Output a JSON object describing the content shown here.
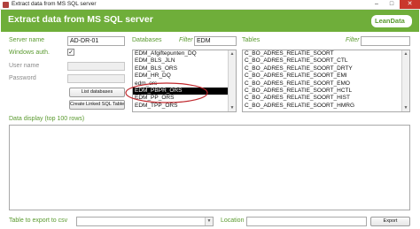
{
  "window": {
    "title": "Extract data from MS SQL server",
    "header_title": "Extract data from MS SQL server",
    "logo": "LeanData",
    "controls": {
      "minimize": "–",
      "maximize": "□",
      "close": "✕"
    },
    "colors": {
      "header": "#6fae3a",
      "accent": "#5a9a2f",
      "close": "#c9372c"
    }
  },
  "connection": {
    "server_name_label": "Server name",
    "server_name_value": "AD-DR-01",
    "windows_auth_label": "Windows auth.",
    "windows_auth_checked": true,
    "check_glyph": "✓",
    "user_name_label": "User name",
    "password_label": "Password",
    "list_databases_button": "List databases",
    "create_linked_button": "Create Linked SQL Table"
  },
  "databases": {
    "label": "Databases",
    "filter_label": "Filter",
    "filter_value": "EDM",
    "items": [
      "EDM_Afgiftepunten_DQ",
      "EDM_BLS_JLN",
      "EDM_BLS_ORS",
      "EDM_HR_DQ",
      "edm_ors",
      "EDM_PBPR_ORS",
      "EDM_PP_ORS",
      "EDM_TPP_ORS"
    ],
    "selected_index": 5,
    "highlight_color": "#c0282d"
  },
  "tables": {
    "label": "Tables",
    "filter_label": "Filter",
    "filter_value": "",
    "items": [
      "C_BO_ADRES_RELATIE_SOORT",
      "C_BO_ADRES_RELATIE_SOORT_CTL",
      "C_BO_ADRES_RELATIE_SOORT_DRTY",
      "C_BO_ADRES_RELATIE_SOORT_EMI",
      "C_BO_ADRES_RELATIE_SOORT_EMO",
      "C_BO_ADRES_RELATIE_SOORT_HCTL",
      "C_BO_ADRES_RELATIE_SOORT_HIST",
      "C_BO_ADRES_RELATIE_SOORT_HMRG"
    ]
  },
  "data_display": {
    "label": "Data display (top 100 rows)"
  },
  "export": {
    "table_label": "Table to export to csv",
    "table_value": "",
    "location_label": "Location",
    "location_value": "",
    "export_button": "Export"
  },
  "icons": {
    "scroll_up": "▲",
    "scroll_down": "▼",
    "dropdown": "▼"
  }
}
